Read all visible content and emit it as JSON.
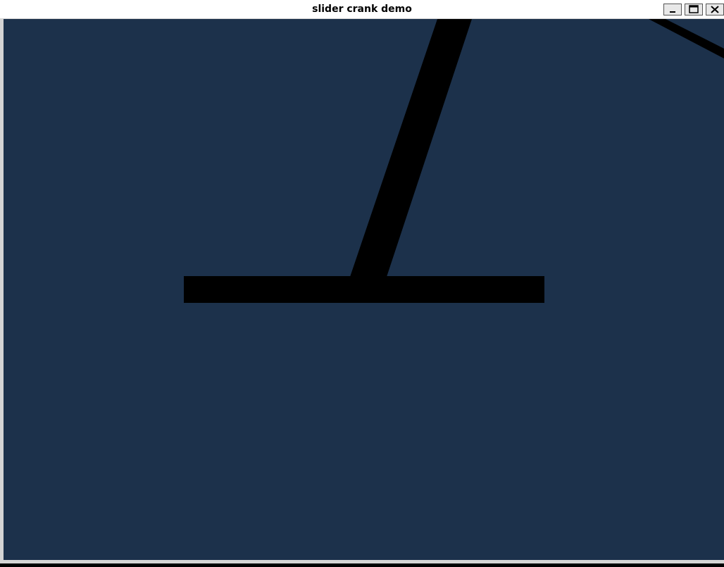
{
  "window": {
    "title": "slider crank demo"
  },
  "controls": {
    "minimize_icon": "minimize-icon",
    "maximize_icon": "maximize-icon",
    "close_icon": "close-icon"
  },
  "colors": {
    "canvas_background": "#1c314b",
    "links": "#000000",
    "titlebar": "#ffffff"
  }
}
